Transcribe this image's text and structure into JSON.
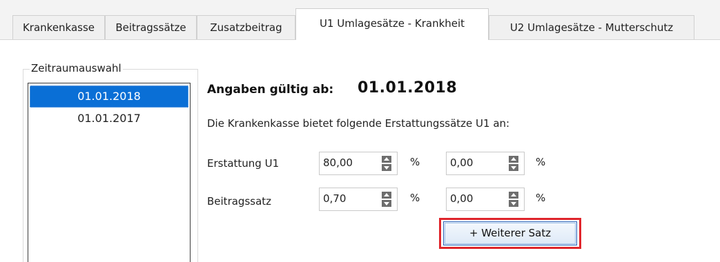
{
  "tabs": [
    {
      "label": "Krankenkasse",
      "active": false
    },
    {
      "label": "Beitragssätze",
      "active": false
    },
    {
      "label": "Zusatzbeitrag",
      "active": false
    },
    {
      "label": "U1 Umlagesätze - Krankheit",
      "active": true
    },
    {
      "label": "U2 Umlagesätze - Mutterschutz",
      "active": false
    }
  ],
  "period": {
    "group_title": "Zeitraumauswahl",
    "items": [
      {
        "label": "01.01.2018",
        "selected": true
      },
      {
        "label": "01.01.2017",
        "selected": false
      }
    ]
  },
  "details": {
    "valid_from_label": "Angaben gültig ab:",
    "valid_from_date": "01.01.2018",
    "description": "Die Krankenkasse bietet folgende Erstattungssätze U1 an:",
    "rows": [
      {
        "label": "Erstattung U1",
        "value1": "80,00",
        "unit1": "%",
        "value2": "0,00",
        "unit2": "%"
      },
      {
        "label": "Beitragssatz",
        "value1": "0,70",
        "unit1": "%",
        "value2": "0,00",
        "unit2": "%"
      }
    ],
    "add_button_label": "+ Weiterer Satz"
  },
  "colors": {
    "selection": "#0a6fd6",
    "button_border": "#2b63b8",
    "highlight": "#e0252b"
  }
}
